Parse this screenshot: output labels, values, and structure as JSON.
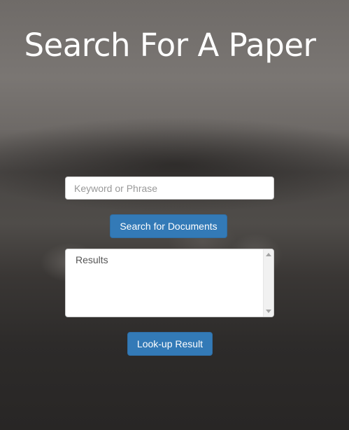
{
  "page": {
    "title": "Search For A Paper"
  },
  "search": {
    "placeholder": "Keyword or Phrase",
    "value": "",
    "button_label": "Search for Documents"
  },
  "results": {
    "placeholder": "Results"
  },
  "lookup": {
    "button_label": "Look-up Result"
  },
  "colors": {
    "primary_button": "#337ab7",
    "button_text": "#ffffff",
    "title_text": "#ffffff"
  }
}
